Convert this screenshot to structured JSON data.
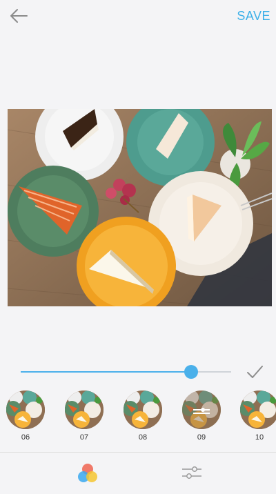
{
  "toolbar": {
    "back_icon": "arrow-left-icon",
    "save_label": "SAVE",
    "accent": "#3db0e8"
  },
  "editor": {
    "photo_icon": "food-photo",
    "intensity": 0.81,
    "confirm_icon": "check-icon"
  },
  "filters": [
    {
      "label": "06",
      "selected": false
    },
    {
      "label": "07",
      "selected": false
    },
    {
      "label": "08",
      "selected": false
    },
    {
      "label": "09",
      "selected": true
    },
    {
      "label": "10",
      "selected": false
    }
  ],
  "bottom_tabs": [
    {
      "icon": "color-filter-icon",
      "active": true
    },
    {
      "icon": "adjust-sliders-icon",
      "active": false
    }
  ]
}
